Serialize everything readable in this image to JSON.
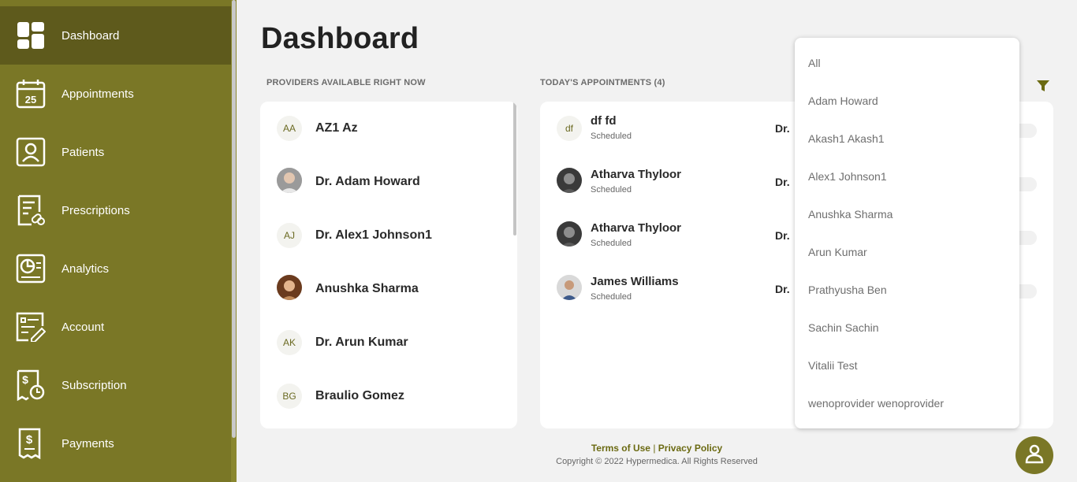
{
  "sidebar": {
    "items": [
      {
        "label": "Dashboard",
        "icon": "dashboard-icon"
      },
      {
        "label": "Appointments",
        "icon": "calendar-icon",
        "icon_text": "25"
      },
      {
        "label": "Patients",
        "icon": "patient-icon"
      },
      {
        "label": "Prescriptions",
        "icon": "prescription-icon"
      },
      {
        "label": "Analytics",
        "icon": "analytics-icon"
      },
      {
        "label": "Account",
        "icon": "account-icon"
      },
      {
        "label": "Subscription",
        "icon": "subscription-icon"
      },
      {
        "label": "Payments",
        "icon": "payments-icon"
      }
    ]
  },
  "main": {
    "title": "Dashboard",
    "providers_heading": "PROVIDERS AVAILABLE RIGHT NOW",
    "appointments_heading": "TODAY'S APPOINTMENTS (4)"
  },
  "providers": [
    {
      "initials": "AA",
      "name": "AZ1 Az",
      "photo": false
    },
    {
      "initials": "",
      "name": "Dr. Adam Howard",
      "photo": true
    },
    {
      "initials": "AJ",
      "name": "Dr. Alex1 Johnson1",
      "photo": false
    },
    {
      "initials": "",
      "name": "Anushka Sharma",
      "photo": true
    },
    {
      "initials": "AK",
      "name": "Dr. Arun Kumar",
      "photo": false
    },
    {
      "initials": "BG",
      "name": "Braulio Gomez",
      "photo": false
    }
  ],
  "appointments": [
    {
      "initials": "df",
      "name": "df fd",
      "status": "Scheduled",
      "doctor": "Dr."
    },
    {
      "initials": "",
      "name": "Atharva Thyloor",
      "status": "Scheduled",
      "doctor": "Dr."
    },
    {
      "initials": "",
      "name": "Atharva Thyloor",
      "status": "Scheduled",
      "doctor": "Dr."
    },
    {
      "initials": "",
      "name": "James Williams",
      "status": "Scheduled",
      "doctor": "Dr."
    }
  ],
  "dropdown": {
    "options": [
      "All",
      "Adam Howard",
      "Akash1 Akash1",
      "Alex1 Johnson1",
      "Anushka Sharma",
      "Arun Kumar",
      "Prathyusha Ben",
      "Sachin Sachin",
      "Vitalii Test",
      "wenoprovider wenoprovider"
    ]
  },
  "footer": {
    "terms": "Terms of Use",
    "separator": "|",
    "privacy": "Privacy Policy",
    "copyright": "Copyright © 2022 Hypermedica. All Rights Reserved"
  },
  "colors": {
    "sidebar": "#7a7726",
    "sidebar_active": "#5e5a1c",
    "accent": "#6b6a12"
  }
}
